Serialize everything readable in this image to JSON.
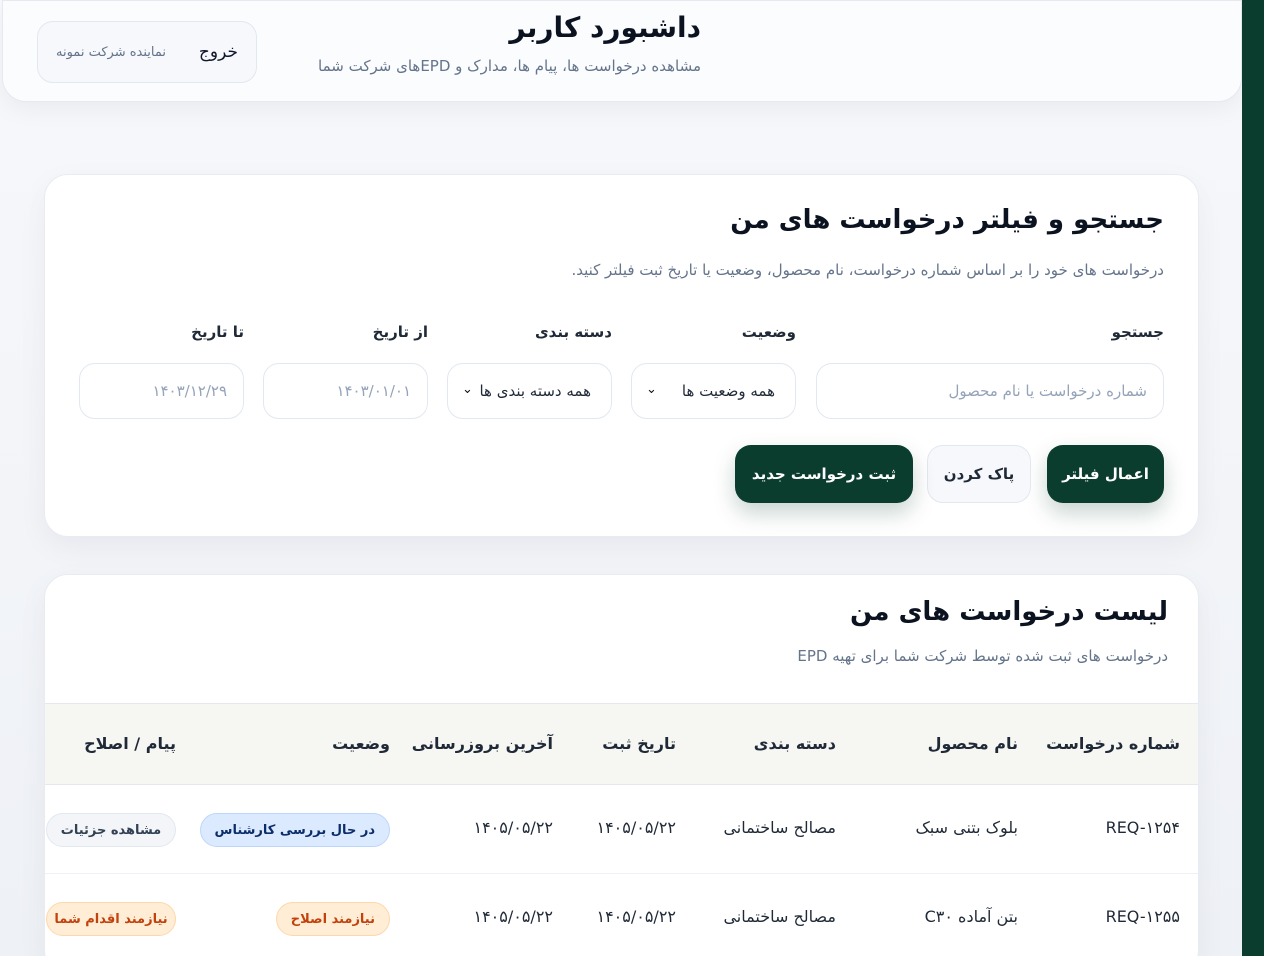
{
  "header": {
    "title": "داشبورد کاربر",
    "subtitle": "مشاهده درخواست ها، پیام ها، مدارک و EPDهای شرکت شما",
    "logout_label": "خروج",
    "user_role": "نماینده شرکت نمونه"
  },
  "filter": {
    "title": "جستجو و فیلتر درخواست های من",
    "description": "درخواست های خود را بر اساس شماره درخواست، نام محصول، وضعیت یا تاریخ ثبت فیلتر کنید.",
    "search_label": "جستجو",
    "search_placeholder": "شماره درخواست یا نام محصول",
    "status_label": "وضعیت",
    "status_value": "همه وضعیت ها",
    "category_label": "دسته بندی",
    "category_value": "همه دسته بندی ها",
    "from_label": "از تاریخ",
    "from_placeholder": "۱۴۰۳/۰۱/۰۱",
    "to_label": "تا تاریخ",
    "to_placeholder": "۱۴۰۳/۱۲/۲۹",
    "apply_label": "اعمال فیلتر",
    "clear_label": "پاک کردن",
    "new_request_label": "ثبت درخواست جدید"
  },
  "list": {
    "title": "لیست درخواست های من",
    "description": "درخواست های ثبت شده توسط شرکت شما برای تهیه EPD",
    "columns": [
      "شماره درخواست",
      "نام محصول",
      "دسته بندی",
      "تاریخ ثبت",
      "آخرین بروزرسانی",
      "وضعیت",
      "پیام / اصلاح"
    ],
    "rows": [
      {
        "id": "REQ-۱۲۵۴",
        "product": "بلوک بتنی سبک",
        "category": "مصالح ساختمانی",
        "created": "۱۴۰۵/۰۵/۲۲",
        "updated": "۱۴۰۵/۰۵/۲۲",
        "status": "در حال بررسی کارشناس",
        "action": "مشاهده جزئیات"
      },
      {
        "id": "REQ-۱۲۵۵",
        "product": "بتن آماده C۳۰",
        "category": "مصالح ساختمانی",
        "created": "۱۴۰۵/۰۵/۲۲",
        "updated": "۱۴۰۵/۰۵/۲۲",
        "status": "نیازمند اصلاح",
        "action": "نیازمند اقدام شما"
      }
    ]
  },
  "colors": {
    "brand": "#0b3d2e",
    "status_review": "#dbeafe",
    "status_fix": "#ffedd5"
  }
}
